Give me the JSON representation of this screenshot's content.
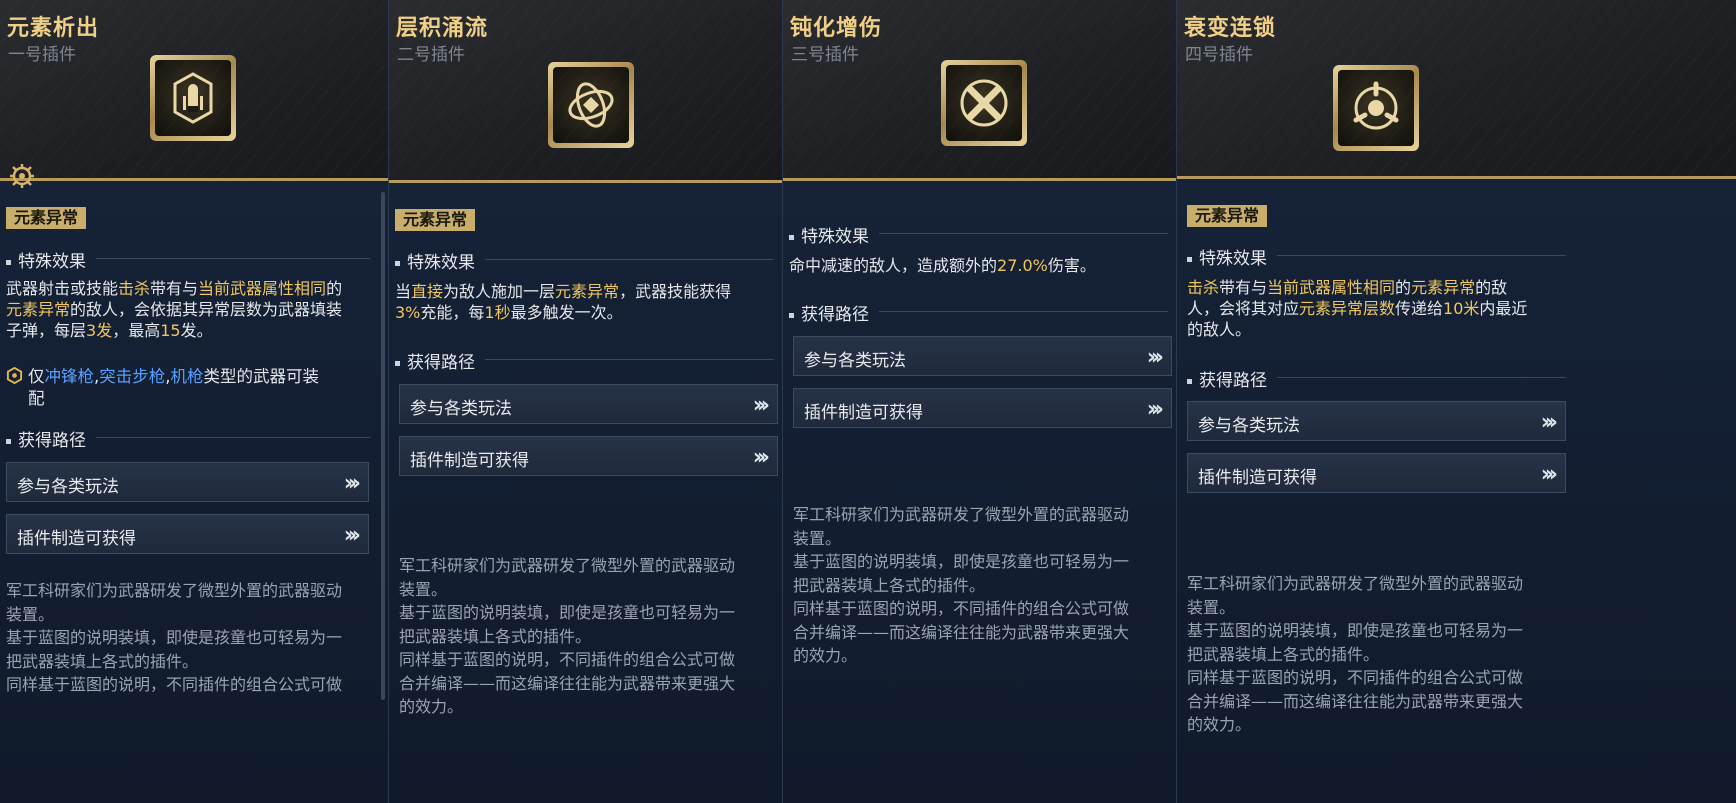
{
  "cards": [
    {
      "title": "元素析出",
      "subtitle": "一号插件",
      "icon": "bullet-plugin-icon",
      "tag": "元素异常",
      "effect_header": "特殊效果",
      "effect_lines": [
        [
          [
            "武器射击或技能",
            ""
          ],
          [
            "击杀",
            "gold"
          ],
          [
            "带有与",
            ""
          ],
          [
            "当前武器属性相同",
            "gold"
          ],
          [
            "的",
            ""
          ]
        ],
        [
          [
            "元素异常",
            "gold"
          ],
          [
            "的敌人，会依据其异常层数为武器填装",
            ""
          ]
        ],
        [
          [
            "子弹，每层",
            ""
          ],
          [
            "3发",
            "gold"
          ],
          [
            "，最高",
            ""
          ],
          [
            "15",
            "gold"
          ],
          [
            "发。",
            ""
          ]
        ]
      ],
      "restriction_lines": [
        [
          [
            "仅",
            ""
          ],
          [
            "冲锋枪",
            "blue"
          ],
          [
            ",",
            ""
          ],
          [
            "突击步枪",
            "blue"
          ],
          [
            ",",
            ""
          ],
          [
            "机枪",
            "blue"
          ],
          [
            "类型的武器可装",
            ""
          ]
        ],
        [
          [
            "配",
            ""
          ]
        ]
      ],
      "source_header": "获得路径",
      "sources": [
        "参与各类玩法",
        "插件制造可获得"
      ],
      "lore_lines": [
        "军工科研家们为武器研发了微型外置的武器驱动",
        "装置。",
        "基于蓝图的说明装填，即使是孩童也可轻易为一",
        "把武器装填上各式的插件。",
        "同样基于蓝图的说明，不同插件的组合公式可做"
      ]
    },
    {
      "title": "层积涌流",
      "subtitle": "二号插件",
      "icon": "surge-plugin-icon",
      "tag": "元素异常",
      "effect_header": "特殊效果",
      "effect_lines": [
        [
          [
            "当",
            ""
          ],
          [
            "直接",
            "gold"
          ],
          [
            "为敌人施加一层",
            ""
          ],
          [
            "元素异常",
            "gold"
          ],
          [
            "，武器技能获得",
            ""
          ]
        ],
        [
          [
            "3%",
            "gold"
          ],
          [
            "充能，每",
            ""
          ],
          [
            "1秒",
            "gold"
          ],
          [
            "最多触发一次。",
            ""
          ]
        ]
      ],
      "source_header": "获得路径",
      "sources": [
        "参与各类玩法",
        "插件制造可获得"
      ],
      "lore_lines": [
        "军工科研家们为武器研发了微型外置的武器驱动",
        "装置。",
        "基于蓝图的说明装填，即使是孩童也可轻易为一",
        "把武器装填上各式的插件。",
        "同样基于蓝图的说明，不同插件的组合公式可做",
        "合并编译——而这编译往往能为武器带来更强大",
        "的效力。"
      ]
    },
    {
      "title": "钝化增伤",
      "subtitle": "三号插件",
      "icon": "blunt-damage-plugin-icon",
      "effect_header": "特殊效果",
      "effect_lines": [
        [
          [
            "命中减速的敌人，造成额外的",
            ""
          ],
          [
            "27.0%",
            "gold"
          ],
          [
            "伤害。",
            ""
          ]
        ]
      ],
      "source_header": "获得路径",
      "sources": [
        "参与各类玩法",
        "插件制造可获得"
      ],
      "lore_lines": [
        "军工科研家们为武器研发了微型外置的武器驱动",
        "装置。",
        "基于蓝图的说明装填，即使是孩童也可轻易为一",
        "把武器装填上各式的插件。",
        "同样基于蓝图的说明，不同插件的组合公式可做",
        "合并编译——而这编译往往能为武器带来更强大",
        "的效力。"
      ]
    },
    {
      "title": "衰变连锁",
      "subtitle": "四号插件",
      "icon": "decay-chain-plugin-icon",
      "tag": "元素异常",
      "effect_header": "特殊效果",
      "effect_lines": [
        [
          [
            "击杀",
            "gold"
          ],
          [
            "带有与",
            ""
          ],
          [
            "当前武器属性相同",
            "gold"
          ],
          [
            "的",
            ""
          ],
          [
            "元素异常",
            "gold"
          ],
          [
            "的敌",
            ""
          ]
        ],
        [
          [
            "人，会将其对应",
            ""
          ],
          [
            "元素异常层数",
            "gold"
          ],
          [
            "传递给",
            ""
          ],
          [
            "10米",
            "gold"
          ],
          [
            "内最近",
            ""
          ]
        ],
        [
          [
            "的敌人。",
            ""
          ]
        ]
      ],
      "source_header": "获得路径",
      "sources": [
        "参与各类玩法",
        "插件制造可获得"
      ],
      "lore_lines": [
        "军工科研家们为武器研发了微型外置的武器驱动",
        "装置。",
        "基于蓝图的说明装填，即使是孩童也可轻易为一",
        "把武器装填上各式的插件。",
        "同样基于蓝图的说明，不同插件的组合公式可做",
        "合并编译——而这编译往往能为武器带来更强大",
        "的效力。"
      ]
    }
  ]
}
